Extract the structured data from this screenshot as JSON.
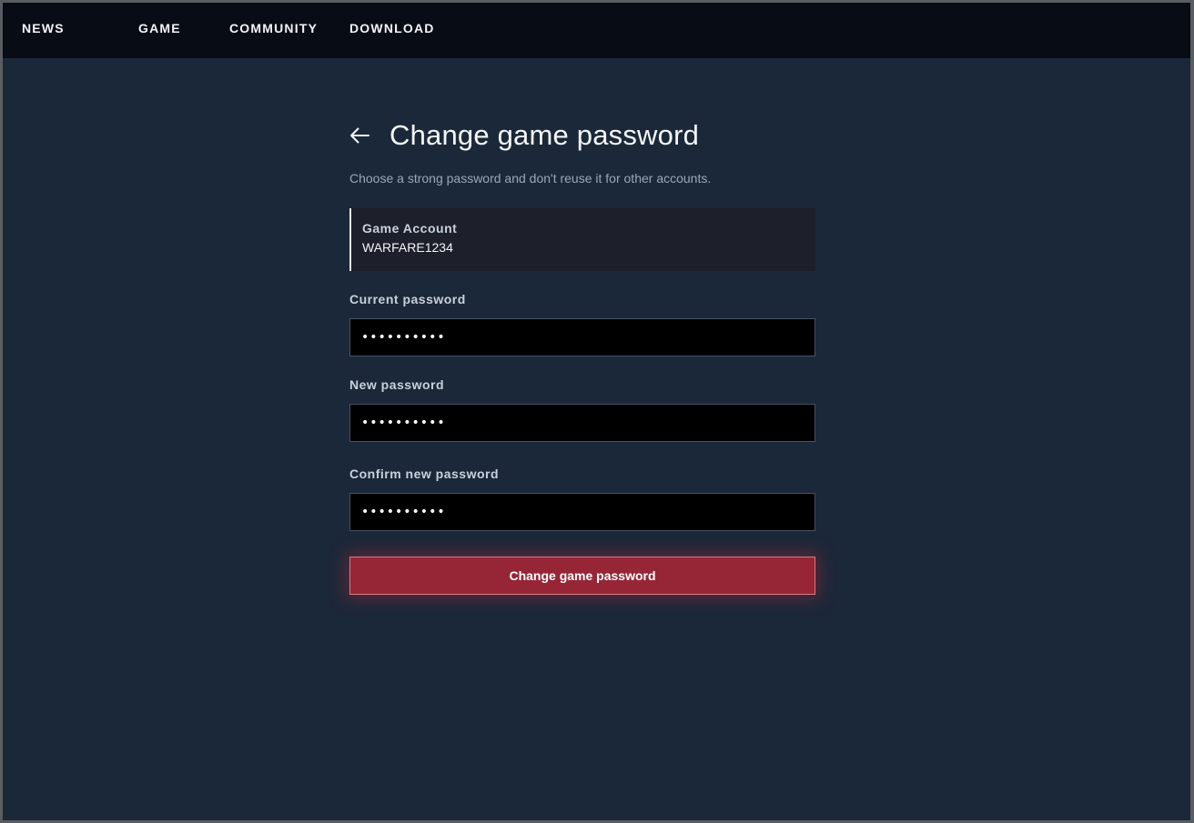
{
  "nav": {
    "items": [
      {
        "label": "NEWS"
      },
      {
        "label": "GAME"
      },
      {
        "label": "COMMUNITY"
      },
      {
        "label": "DOWNLOAD"
      }
    ]
  },
  "page": {
    "back_icon": "arrow-left-icon",
    "title": "Change game password",
    "subtitle": "Choose a strong password and don't reuse it for other accounts."
  },
  "account": {
    "label": "Game Account",
    "value": "WARFARE1234"
  },
  "form": {
    "current_password": {
      "label": "Current password",
      "value": "••••••••••"
    },
    "new_password": {
      "label": "New password",
      "value": "••••••••••"
    },
    "confirm_password": {
      "label": "Confirm new password",
      "value": "••••••••••"
    },
    "submit_label": "Change game password"
  },
  "colors": {
    "background": "#1b2839",
    "nav_background": "#080c14",
    "accent_button": "#962636",
    "card_background": "#1d1f2a"
  }
}
